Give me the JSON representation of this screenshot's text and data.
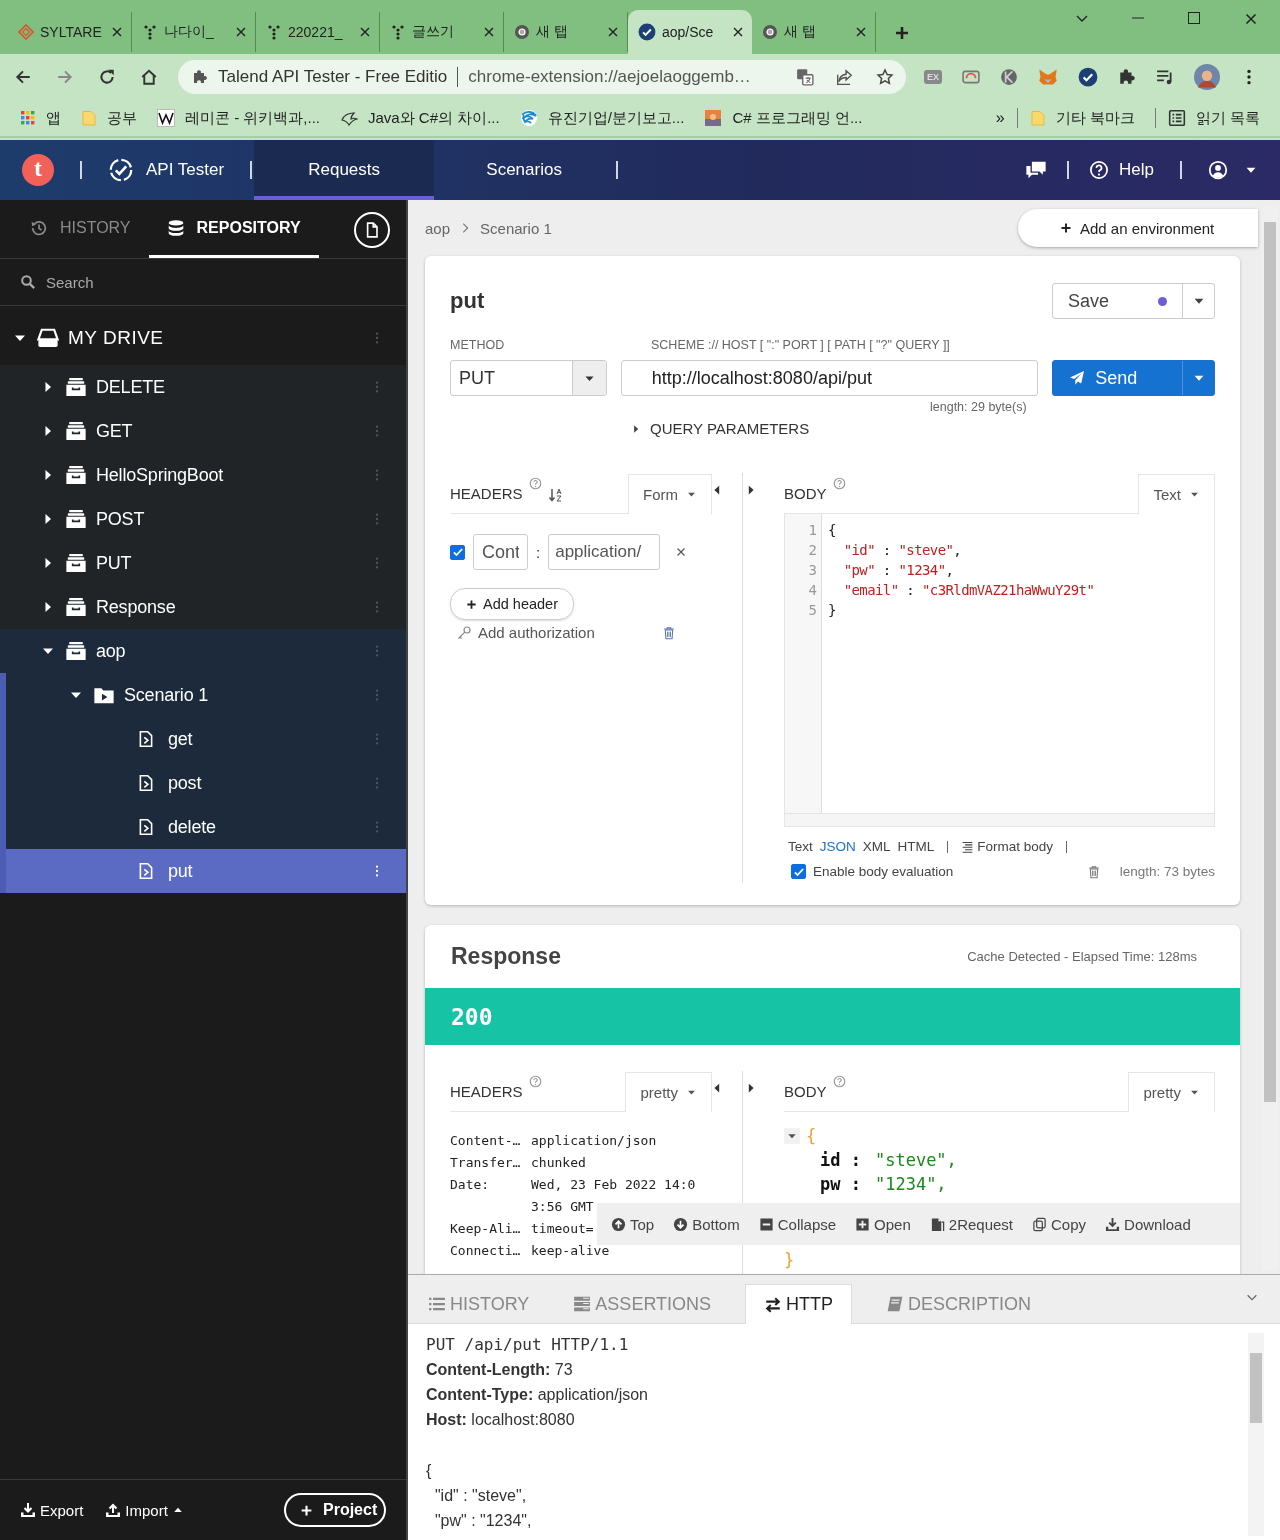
{
  "browser": {
    "tabs": [
      {
        "title": "SYLTARE",
        "selected": false
      },
      {
        "title": "나다이_",
        "selected": false
      },
      {
        "title": "220221_",
        "selected": false
      },
      {
        "title": "글쓰기",
        "selected": false
      },
      {
        "title": "새 탭",
        "selected": false
      },
      {
        "title": "aop/Sce",
        "selected": true
      },
      {
        "title": "새 탭",
        "selected": false
      }
    ],
    "address": {
      "page_title": "Talend API Tester - Free Editio",
      "url": "chrome-extension://aejoelaoggemb…"
    },
    "extension_badge": "EX",
    "bookmarks": [
      {
        "label": "앱"
      },
      {
        "label": "공부"
      },
      {
        "label": "레미콘 - 위키백과,..."
      },
      {
        "label": "Java와 C#의 차이..."
      },
      {
        "label": "유진기업/분기보고..."
      },
      {
        "label": "C# 프로그래밍 언..."
      }
    ],
    "more": "»",
    "other_bookmarks": "기타 북마크",
    "reading_list": "읽기 목록"
  },
  "header": {
    "logo": "t",
    "product": "API Tester",
    "nav": [
      {
        "label": "Requests",
        "selected": true
      },
      {
        "label": "Scenarios",
        "selected": false
      }
    ],
    "help": "Help"
  },
  "sidebar": {
    "tabs": [
      {
        "label": "HISTORY",
        "selected": false
      },
      {
        "label": "REPOSITORY",
        "selected": true
      }
    ],
    "search": {
      "placeholder": "Search"
    },
    "tree": [
      {
        "label": "MY DRIVE",
        "kind": "drive",
        "expanded": true,
        "selected": false,
        "children": [
          {
            "label": "DELETE",
            "kind": "project",
            "expanded": false,
            "selected": false
          },
          {
            "label": "GET",
            "kind": "project",
            "expanded": false,
            "selected": false
          },
          {
            "label": "HelloSpringBoot",
            "kind": "project",
            "expanded": false,
            "selected": false
          },
          {
            "label": "POST",
            "kind": "project",
            "expanded": false,
            "selected": false
          },
          {
            "label": "PUT",
            "kind": "project",
            "expanded": false,
            "selected": false
          },
          {
            "label": "Response",
            "kind": "project",
            "expanded": false,
            "selected": false
          },
          {
            "label": "aop",
            "kind": "project",
            "expanded": true,
            "selected": false,
            "children": [
              {
                "label": "Scenario 1",
                "kind": "scenario",
                "expanded": true,
                "selected": false,
                "children": [
                  {
                    "label": "get",
                    "kind": "request",
                    "selected": false
                  },
                  {
                    "label": "post",
                    "kind": "request",
                    "selected": false
                  },
                  {
                    "label": "delete",
                    "kind": "request",
                    "selected": false
                  },
                  {
                    "label": "put",
                    "kind": "request",
                    "selected": true
                  }
                ]
              }
            ]
          }
        ]
      }
    ],
    "export": "Export",
    "import": "Import",
    "project": "Project"
  },
  "breadcrumb": [
    "aop",
    "Scenario 1"
  ],
  "add_environment": "Add an environment",
  "request": {
    "name": "put",
    "save": "Save",
    "unsaved": true,
    "method_label": "METHOD",
    "method": "PUT",
    "url_label": "SCHEME :// HOST [ \":\" PORT ] [ PATH [ \"?\" QUERY ]]",
    "url": "http://localhost:8080/api/put",
    "url_length": "length: 29 byte(s)",
    "send": "Send",
    "query_parameters": {
      "label": "QUERY PARAMETERS",
      "expanded": false
    },
    "headers": {
      "label": "HEADERS",
      "mode": "Form",
      "rows": [
        {
          "enabled": true,
          "name": "Cont",
          "separator": ":",
          "value": "application/"
        }
      ],
      "add_header": "Add header",
      "add_authorization": "Add authorization"
    },
    "body": {
      "label": "BODY",
      "mode": "Text",
      "lines": [
        {
          "number": "1",
          "code": "{"
        },
        {
          "number": "2",
          "code": "  \"id\" : \"steve\","
        },
        {
          "number": "3",
          "code": "  \"pw\" : \"1234\","
        },
        {
          "number": "4",
          "code": "  \"email\" : \"c3RldmVAZ21haWwuY29t\""
        },
        {
          "number": "5",
          "code": "}"
        }
      ],
      "formats": [
        {
          "label": "Text",
          "selected": false
        },
        {
          "label": "JSON",
          "selected": true
        },
        {
          "label": "XML",
          "selected": false
        },
        {
          "label": "HTML",
          "selected": false
        }
      ],
      "format_body": "Format body",
      "evaluation": {
        "label": "Enable body evaluation",
        "checked": true
      },
      "length": "length: 73 bytes"
    }
  },
  "response": {
    "title": "Response",
    "timing": "Cache Detected - Elapsed Time: 128ms",
    "status": "200",
    "headers": {
      "label": "HEADERS",
      "mode": "pretty",
      "rows": [
        {
          "name": "Content-…",
          "value": "application/json"
        },
        {
          "name": "Transfer…",
          "value": "chunked"
        },
        {
          "name": "Date:",
          "value": "Wed, 23 Feb 2022 14:03:56 GMT"
        },
        {
          "name": "Keep-Ali…",
          "value": "timeout="
        },
        {
          "name": "Connecti…",
          "value": "keep-alive"
        }
      ]
    },
    "body": {
      "label": "BODY",
      "mode": "pretty",
      "expanded": true,
      "open": "{",
      "fields": [
        {
          "key": "id :",
          "value": "\"steve\","
        },
        {
          "key": "pw :",
          "value": "\"1234\","
        }
      ],
      "close": "}"
    },
    "actions": [
      {
        "label": "Top"
      },
      {
        "label": "Bottom"
      },
      {
        "label": "Collapse"
      },
      {
        "label": "Open"
      },
      {
        "label": "2Request"
      },
      {
        "label": "Copy"
      },
      {
        "label": "Download"
      }
    ]
  },
  "details": {
    "tabs": [
      {
        "label": "HISTORY",
        "selected": false
      },
      {
        "label": "ASSERTIONS",
        "selected": false
      },
      {
        "label": "HTTP",
        "selected": true
      },
      {
        "label": "DESCRIPTION",
        "selected": false
      }
    ],
    "lines": [
      {
        "kind": "request_line",
        "text": "PUT /api/put HTTP/1.1"
      },
      {
        "kind": "header",
        "text": "**Content-Length:** 73"
      },
      {
        "kind": "header",
        "text": "**Content-Type:** application/json"
      },
      {
        "kind": "header",
        "text": "**Host:** localhost:8080"
      },
      {
        "kind": "body",
        "text": "{"
      },
      {
        "kind": "body",
        "text": "  \"id\" : \"steve\","
      },
      {
        "kind": "body",
        "text": "  \"pw\" : \"1234\","
      }
    ]
  }
}
